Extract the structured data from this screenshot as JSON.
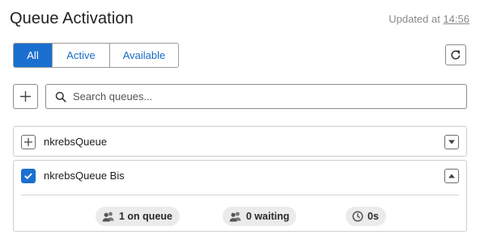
{
  "header": {
    "title": "Queue Activation",
    "updated_prefix": "Updated at ",
    "updated_time": "14:56"
  },
  "filters": [
    {
      "label": "All",
      "active": true
    },
    {
      "label": "Active",
      "active": false
    },
    {
      "label": "Available",
      "active": false
    }
  ],
  "toolbar": {
    "refresh_icon": "refresh-icon",
    "add_icon": "plus-icon"
  },
  "search": {
    "placeholder": "Search queues...",
    "value": "",
    "icon": "search-icon"
  },
  "queues": [
    {
      "name": "nkrebsQueue",
      "selected": false,
      "expanded": false
    },
    {
      "name": "nkrebsQueue Bis",
      "selected": true,
      "expanded": true,
      "stats": [
        {
          "icon": "users-icon",
          "label": "1 on queue"
        },
        {
          "icon": "users-icon",
          "label": "0 waiting"
        },
        {
          "icon": "clock-icon",
          "label": "0s"
        }
      ]
    }
  ],
  "colors": {
    "accent": "#1a6fcf",
    "border": "#8c8c8c",
    "chip_bg": "#ebebeb"
  }
}
